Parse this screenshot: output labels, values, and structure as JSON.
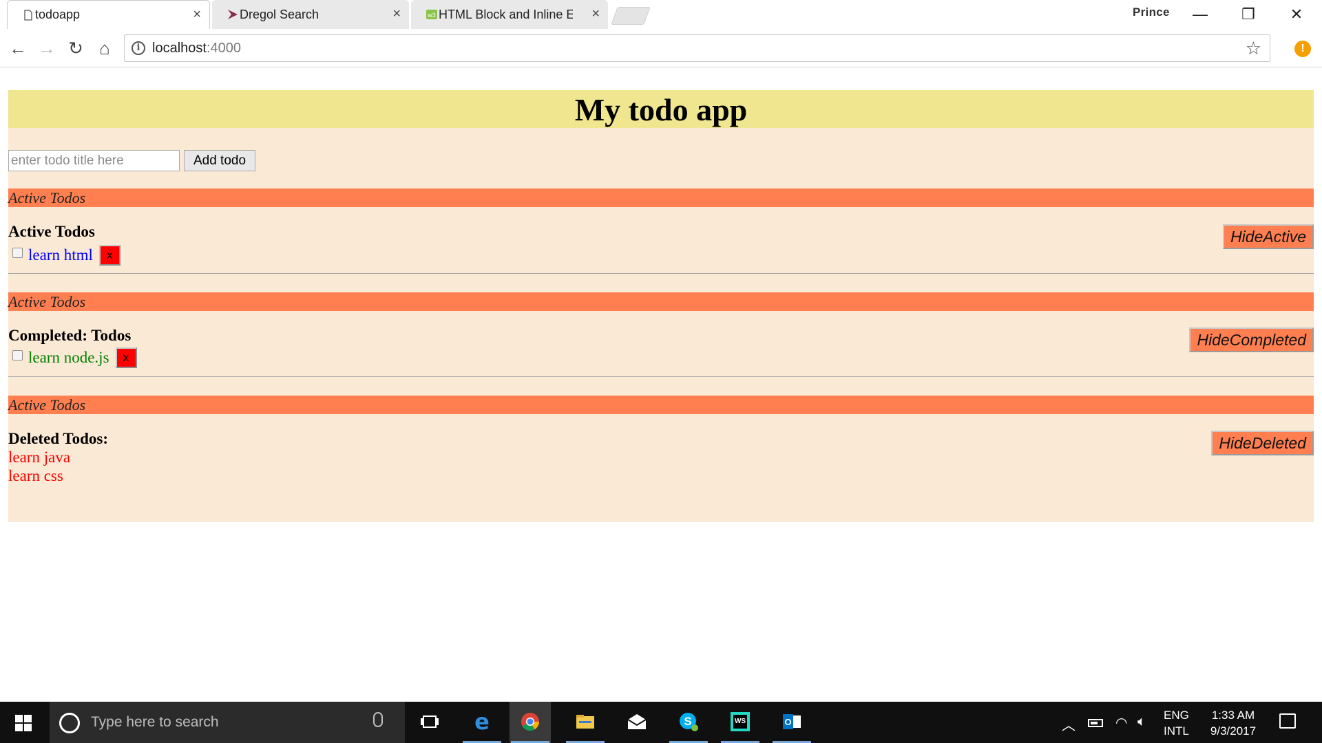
{
  "browser": {
    "tabs": [
      {
        "title": "todoapp"
      },
      {
        "title": "Dregol Search"
      },
      {
        "title": "HTML Block and Inline El"
      }
    ],
    "tab_close_glyph": "×",
    "profile_name": "Prince",
    "window_controls": {
      "minimize": "—",
      "restore": "❐",
      "close": "✕"
    },
    "nav": {
      "back": "←",
      "forward": "→",
      "reload": "↻",
      "home": "⌂"
    },
    "address": {
      "host": "localhost",
      "port": ":4000",
      "info_glyph": "i",
      "star_glyph": "☆"
    },
    "extension_badge": "!"
  },
  "app": {
    "header_title": "My todo app",
    "input": {
      "placeholder": "enter todo title here",
      "value": ""
    },
    "add_button_label": "Add todo",
    "sections": [
      {
        "bar_label": "Active Todos",
        "title": "Active Todos",
        "hide_button_label": "HideActive",
        "items": [
          {
            "text": "learn html",
            "color": "#0000ff",
            "delete_label": "x"
          }
        ]
      },
      {
        "bar_label": "Active Todos",
        "title": "Completed: Todos",
        "hide_button_label": "HideCompleted",
        "items": [
          {
            "text": "learn node.js",
            "color": "#008000",
            "delete_label": "x"
          }
        ]
      },
      {
        "bar_label": "Active Todos",
        "title": "Deleted Todos:",
        "hide_button_label": "HideDeleted",
        "items": [
          {
            "text": "learn java"
          },
          {
            "text": "learn css"
          }
        ]
      }
    ],
    "colors": {
      "header_bg": "#efe68f",
      "page_bg": "#fae9d5",
      "section_bar": "#ff7f50",
      "delete_button": "#ff0000",
      "deleted_text": "#ff0000"
    }
  },
  "taskbar": {
    "search_placeholder": "Type here to search",
    "apps": [
      {
        "name": "task-view-icon"
      },
      {
        "name": "edge-icon"
      },
      {
        "name": "chrome-icon",
        "active": true
      },
      {
        "name": "file-explorer-icon"
      },
      {
        "name": "mail-icon"
      },
      {
        "name": "skype-icon"
      },
      {
        "name": "webstorm-icon"
      },
      {
        "name": "outlook-icon"
      }
    ],
    "tray": {
      "lang_line1": "ENG",
      "lang_line2": "INTL",
      "time": "1:33 AM",
      "date": "9/3/2017"
    }
  }
}
